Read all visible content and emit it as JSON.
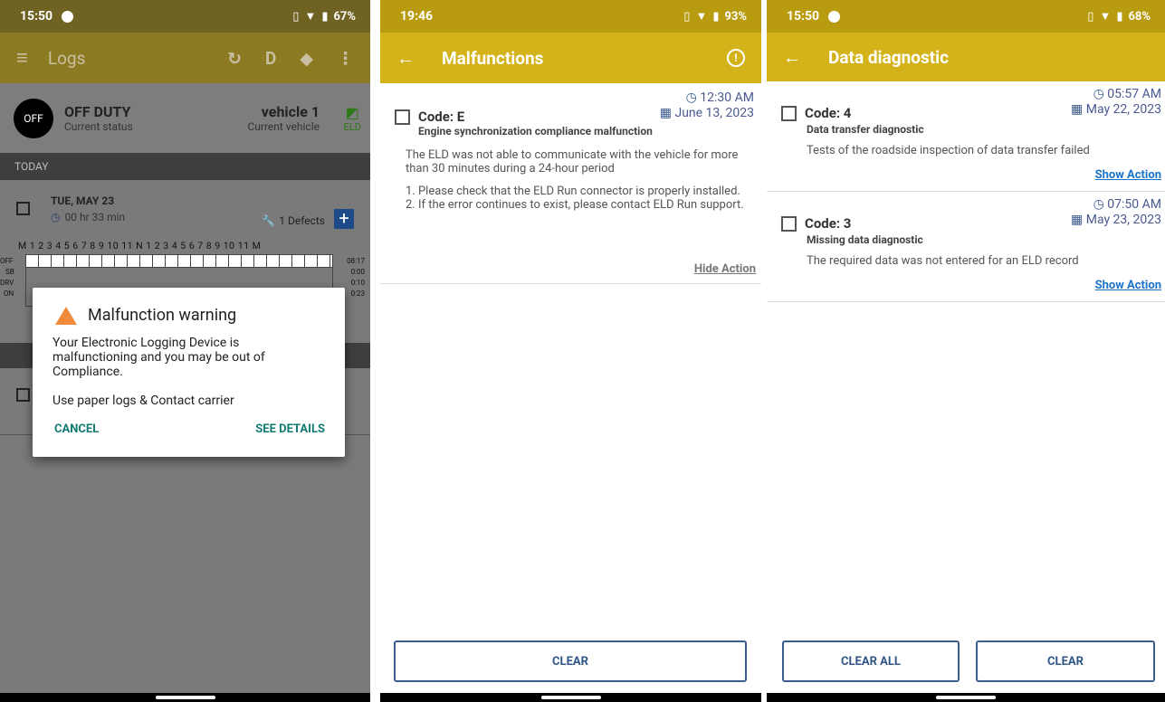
{
  "panel1": {
    "status_time": "15:50",
    "battery": "67%",
    "title": "Logs",
    "header_letter": "D",
    "status_badge": "OFF",
    "status_label": "OFF DUTY",
    "status_sub": "Current status",
    "vehicle_label": "vehicle 1",
    "vehicle_sub": "Current vehicle",
    "eld": "ELD",
    "today": "TODAY",
    "day_label": "TUE, MAY 23",
    "duration": "00 hr  33 min",
    "defects": "1 Defects",
    "hours_row": "M 1 2 3 4 5 6 7 8 9 10 11 N 1 2 3 4 5 6 7 8 9 10 11 M",
    "row_labels": [
      "OFF",
      "SB",
      "DRV",
      "ON"
    ],
    "row_values": [
      "08:17",
      "0:00",
      "0:10",
      "0:23"
    ],
    "dialog": {
      "title": "Malfunction warning",
      "message": "Your Electronic Logging Device is malfunctioning and you may be out of Compliance.",
      "note": "Use paper logs & Contact carrier",
      "cancel": "CANCEL",
      "details": "SEE DETAILS"
    }
  },
  "panel2": {
    "status_time": "19:46",
    "battery": "93%",
    "title": "Malfunctions",
    "item": {
      "code": "Code: E",
      "subtitle": "Engine synchronization compliance malfunction",
      "time": "12:30 AM",
      "date": "June 13, 2023",
      "desc": "The ELD was not able to communicate with the vehicle for more than 30 minutes during a 24-hour period",
      "action1": "1. Please check that the ELD Run connector is properly installed.",
      "action2": "2. If the error continues to exist, please contact ELD Run support.",
      "link": "Hide Action"
    },
    "clear": "CLEAR"
  },
  "panel3": {
    "status_time": "15:50",
    "battery": "68%",
    "title": "Data diagnostic",
    "items": [
      {
        "code": "Code: 4",
        "subtitle": "Data transfer diagnostic",
        "time": "05:57 AM",
        "date": "May 22, 2023",
        "desc": "Tests of the roadside inspection of data transfer failed",
        "link": "Show Action"
      },
      {
        "code": "Code: 3",
        "subtitle": "Missing data diagnostic",
        "time": "07:50 AM",
        "date": "May 23, 2023",
        "desc": "The required data was not entered for an ELD record",
        "link": "Show Action"
      }
    ],
    "clear_all": "CLEAR ALL",
    "clear": "CLEAR"
  },
  "colors": {
    "accent": "#d4b21a",
    "link": "#1a73c9",
    "teal": "#0f7b72"
  }
}
